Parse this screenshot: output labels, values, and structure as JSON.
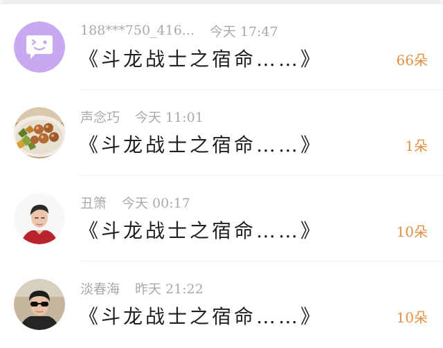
{
  "messages": [
    {
      "sender": "188***750_416...",
      "time": "今天 17:47",
      "title": "《斗龙战士之宿命……》",
      "count": "66朵",
      "avatar": "wink-face-avatar"
    },
    {
      "sender": "声念巧",
      "time": "今天 11:01",
      "title": "《斗龙战士之宿命……》",
      "count": "1朵",
      "avatar": "food-plate-avatar"
    },
    {
      "sender": "丑箫",
      "time": "今天 00:17",
      "title": "《斗龙战士之宿命……》",
      "count": "10朵",
      "avatar": "young-man-red-shirt-avatar"
    },
    {
      "sender": "淡春海",
      "time": "昨天 21:22",
      "title": "《斗龙战士之宿命……》",
      "count": "10朵",
      "avatar": "man-sunglasses-avatar"
    }
  ],
  "colors": {
    "avatar_purple": "#c9a8f2",
    "count_orange": "#e78d43",
    "meta_gray": "#a9a9a9"
  }
}
